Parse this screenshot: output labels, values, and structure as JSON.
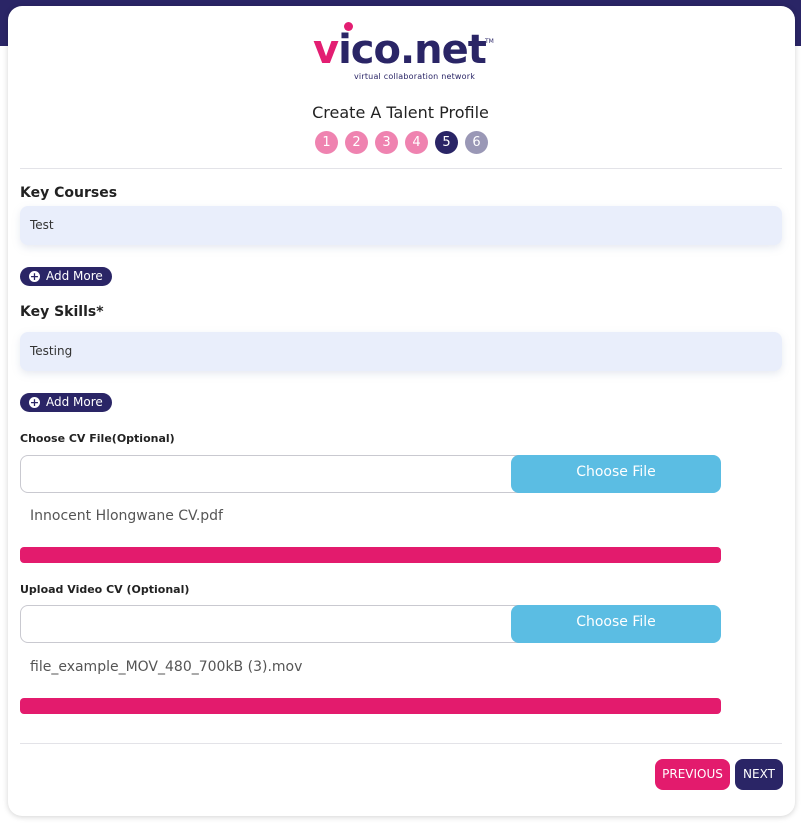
{
  "brand": {
    "name_v": "v",
    "name_rest": "ico.net",
    "tm": "TM",
    "tagline": "virtual collaboration network",
    "colors": {
      "navy": "#2a2566",
      "pink": "#e31e72",
      "light_pink": "#ef83b0",
      "sky": "#5bbde3"
    }
  },
  "page_title": "Create A Talent Profile",
  "steps": [
    {
      "label": "1",
      "state": "done"
    },
    {
      "label": "2",
      "state": "done"
    },
    {
      "label": "3",
      "state": "done"
    },
    {
      "label": "4",
      "state": "done"
    },
    {
      "label": "5",
      "state": "active"
    },
    {
      "label": "6",
      "state": "todo"
    }
  ],
  "key_courses": {
    "label": "Key Courses",
    "value": "Test",
    "add_more": "Add More"
  },
  "key_skills": {
    "label": "Key Skills*",
    "value": "Testing",
    "add_more": "Add More"
  },
  "cv_file": {
    "label": "Choose CV File(Optional)",
    "button": "Choose File",
    "file_name": "Innocent Hlongwane CV.pdf",
    "progress": 1.0
  },
  "video_cv": {
    "label": "Upload Video CV (Optional)",
    "button": "Choose File",
    "file_name": "file_example_MOV_480_700kB (3).mov",
    "progress": 1.0
  },
  "nav": {
    "previous": "PREVIOUS",
    "next": "NEXT"
  }
}
